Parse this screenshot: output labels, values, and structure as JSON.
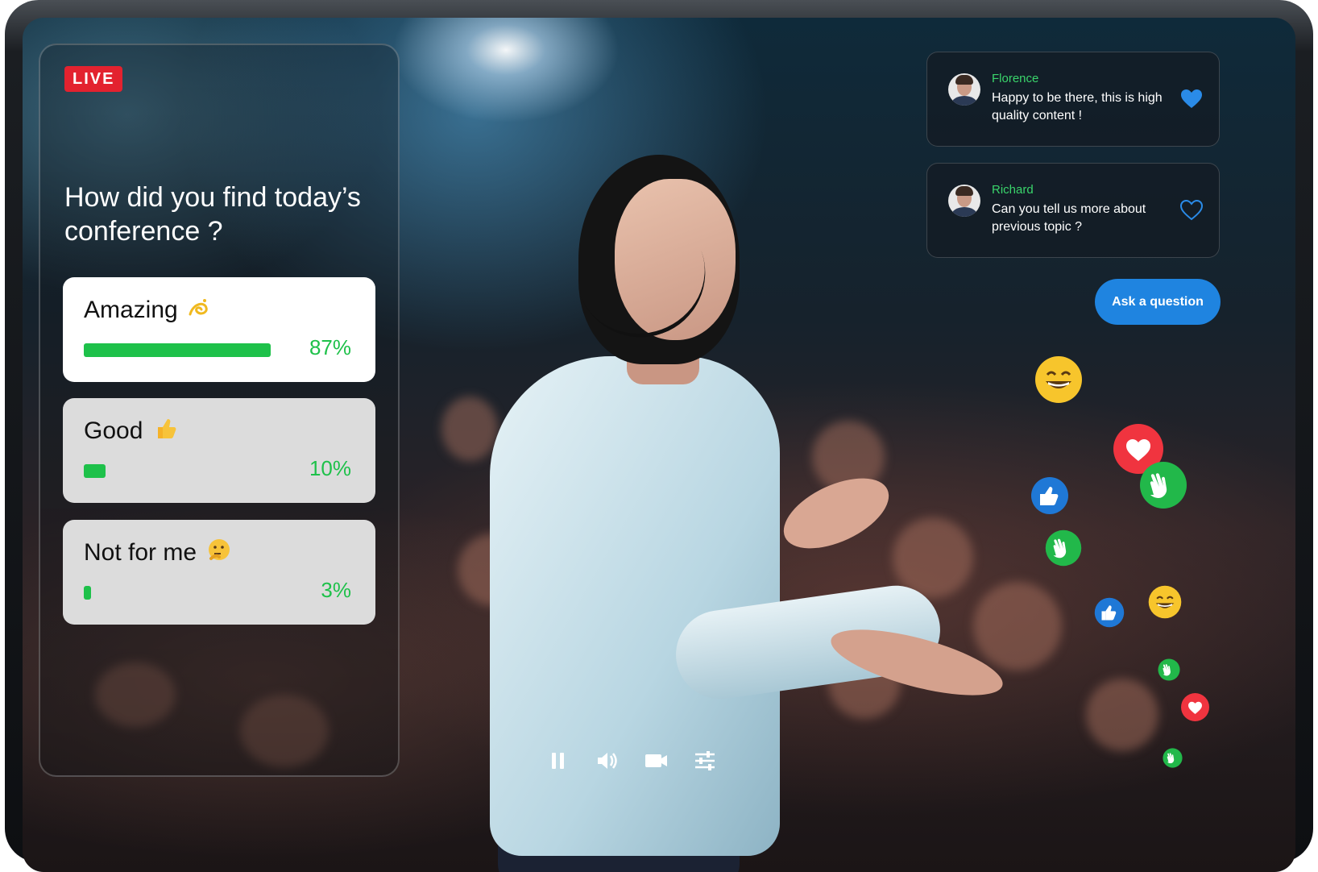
{
  "live_badge": "LIVE",
  "poll": {
    "question": "How did you find today’s conference ?",
    "options": [
      {
        "label": "Amazing",
        "emoji": "dizzy-icon",
        "percent": 87,
        "percent_label": "87%",
        "selected": true
      },
      {
        "label": "Good",
        "emoji": "thumbs-up-icon",
        "percent": 10,
        "percent_label": "10%",
        "selected": false
      },
      {
        "label": "Not for me",
        "emoji": "thinking-face-icon",
        "percent": 3,
        "percent_label": "3%",
        "selected": false
      }
    ]
  },
  "chat": {
    "messages": [
      {
        "name": "Florence",
        "text": "Happy to be there, this is high quality content !",
        "liked": true
      },
      {
        "name": "Richard",
        "text": "Can you tell us more about previous topic ?",
        "liked": false
      }
    ],
    "ask_button_label": "Ask a question"
  },
  "reactions": [
    "grinning-face-icon",
    "heart-icon",
    "thumbs-up-icon",
    "clapping-hands-icon"
  ],
  "controls": [
    "pause-icon",
    "volume-icon",
    "camera-icon",
    "settings-sliders-icon"
  ],
  "colors": {
    "accent_green": "#1ec14a",
    "live_red": "#e3222f",
    "ask_blue": "#1f84e0",
    "heart_blue": "#2a8be8"
  }
}
